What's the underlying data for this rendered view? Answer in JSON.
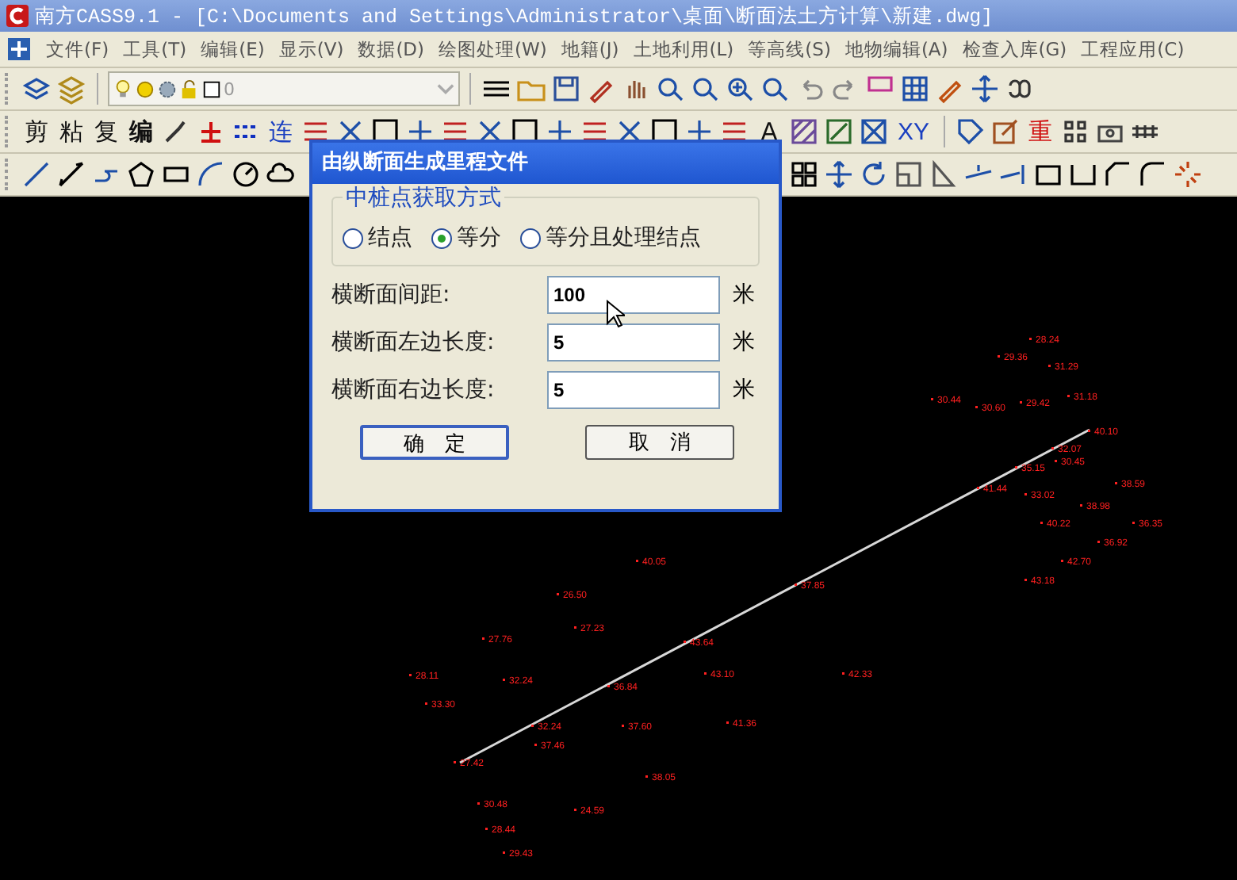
{
  "window": {
    "title": "南方CASS9.1 - [C:\\Documents and Settings\\Administrator\\桌面\\断面法土方计算\\新建.dwg]"
  },
  "menu": [
    "文件(F)",
    "工具(T)",
    "编辑(E)",
    "显示(V)",
    "数据(D)",
    "绘图处理(W)",
    "地籍(J)",
    "土地利用(L)",
    "等高线(S)",
    "地物编辑(A)",
    "检查入库(G)",
    "工程应用(C)"
  ],
  "layer_combo": {
    "value": "0"
  },
  "toolbar_glyphs": [
    "剪",
    "粘",
    "复",
    "编",
    "连",
    "A",
    "XY",
    "重"
  ],
  "dialog": {
    "title": "由纵断面生成里程文件",
    "group": {
      "title": "中桩点获取方式",
      "options": [
        {
          "label": "结点",
          "selected": false
        },
        {
          "label": "等分",
          "selected": true
        },
        {
          "label": "等分且处理结点",
          "selected": false
        }
      ]
    },
    "fields": [
      {
        "label": "横断面间距:",
        "value": "100",
        "unit": "米"
      },
      {
        "label": "横断面左边长度:",
        "value": "5",
        "unit": "米"
      },
      {
        "label": "横断面右边长度:",
        "value": "5",
        "unit": "米"
      }
    ],
    "buttons": [
      "确　定",
      "取　消"
    ]
  },
  "canvas": {
    "elevations": [
      "28.24",
      "29.36",
      "31.29",
      "30.44",
      "30.60",
      "29.42",
      "31.18",
      "40.10",
      "32.07",
      "30.45",
      "35.15",
      "41.44",
      "33.02",
      "38.59",
      "38.98",
      "36.35",
      "40.22",
      "36.92",
      "42.70",
      "43.18",
      "40.05",
      "26.50",
      "27.23",
      "27.76",
      "28.11",
      "32.24",
      "33.30",
      "36.84",
      "43.64",
      "37.85",
      "43.10",
      "42.33",
      "32.24",
      "37.46",
      "37.60",
      "41.36",
      "27.42",
      "38.05",
      "30.48",
      "24.59",
      "28.44",
      "29.43"
    ]
  }
}
